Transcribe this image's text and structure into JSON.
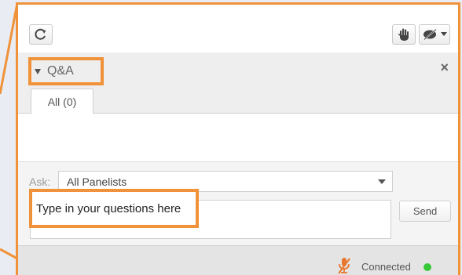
{
  "toolbar": {
    "icons": [
      "refresh-icon",
      "raise-hand-icon",
      "emoticon-icon",
      "chevron-down-icon"
    ]
  },
  "qa": {
    "title": "Q&A",
    "close_symbol": "×"
  },
  "tabs": [
    {
      "label": "All (0)",
      "selected": true
    }
  ],
  "ask": {
    "label": "Ask:",
    "selected_option": "All Panelists"
  },
  "question": {
    "placeholder": "Type in your questions here"
  },
  "send": {
    "label": "Send"
  },
  "status": {
    "text": "Connected",
    "indicator_color": "#37c837"
  },
  "colors": {
    "highlight": "#f0923a",
    "mute_icon": "#e8772e"
  }
}
